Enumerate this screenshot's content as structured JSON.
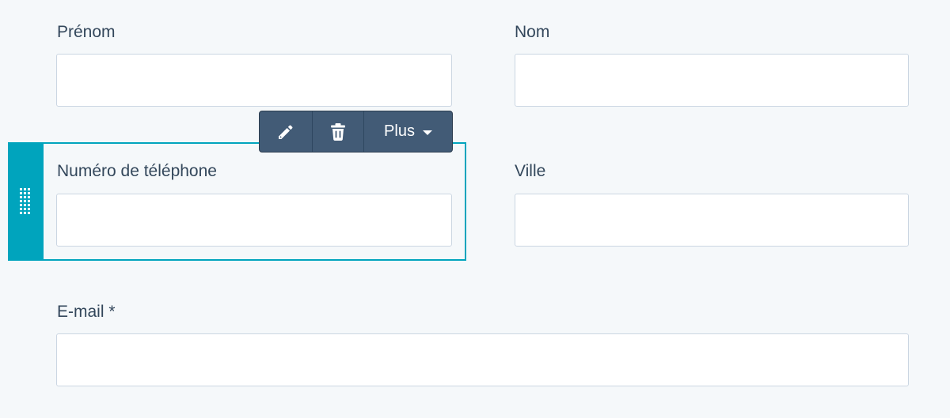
{
  "form": {
    "first_name": {
      "label": "Prénom",
      "value": ""
    },
    "last_name": {
      "label": "Nom",
      "value": ""
    },
    "phone": {
      "label": "Numéro de téléphone",
      "value": ""
    },
    "city": {
      "label": "Ville",
      "value": ""
    },
    "email": {
      "label": "E-mail *",
      "value": ""
    }
  },
  "toolbar": {
    "edit_icon": "pencil-icon",
    "delete_icon": "trash-icon",
    "more_label": "Plus",
    "more_icon": "caret-down-icon"
  },
  "colors": {
    "background": "#f5f8fa",
    "selection_accent": "#00a4bd",
    "toolbar_bg": "#425b76",
    "text": "#33475b",
    "input_border": "#cbd6e2"
  }
}
